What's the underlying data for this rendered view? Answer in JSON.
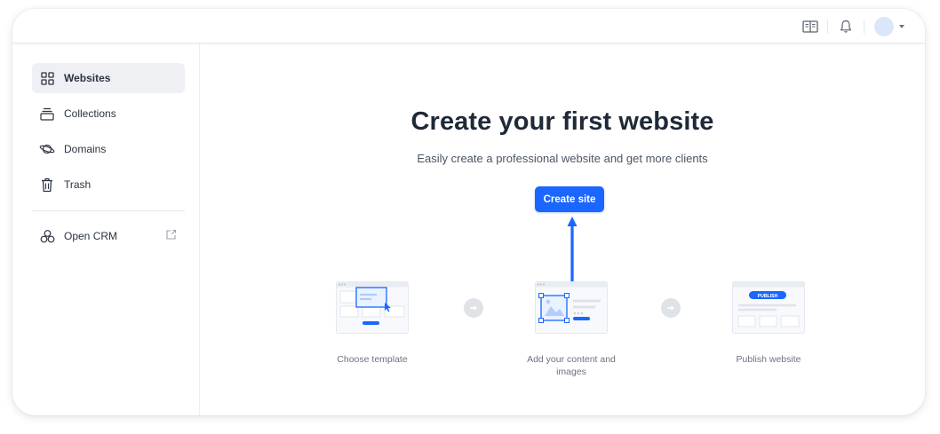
{
  "header": {
    "icons": [
      "book-icon",
      "bell-icon"
    ],
    "avatar_color": "#dce6fb"
  },
  "sidebar": {
    "items": [
      {
        "label": "Websites",
        "icon": "grid-icon",
        "active": true
      },
      {
        "label": "Collections",
        "icon": "collections-icon",
        "active": false
      },
      {
        "label": "Domains",
        "icon": "planet-icon",
        "active": false
      },
      {
        "label": "Trash",
        "icon": "trash-icon",
        "active": false
      }
    ],
    "crm": {
      "label": "Open CRM",
      "icon": "crm-icon",
      "trailing_icon": "external-link-icon"
    }
  },
  "main": {
    "title": "Create your first website",
    "subtitle": "Easily create a professional website and get more clients",
    "cta_label": "Create site",
    "steps": [
      {
        "label": "Choose template",
        "icon": "template-illustration"
      },
      {
        "label": "Add your content and images",
        "icon": "content-illustration"
      },
      {
        "label": "Publish website",
        "icon": "publish-illustration",
        "badge": "PUBLISH"
      }
    ]
  },
  "colors": {
    "accent": "#1a66ff",
    "active_nav_bg": "#eef0f4"
  }
}
